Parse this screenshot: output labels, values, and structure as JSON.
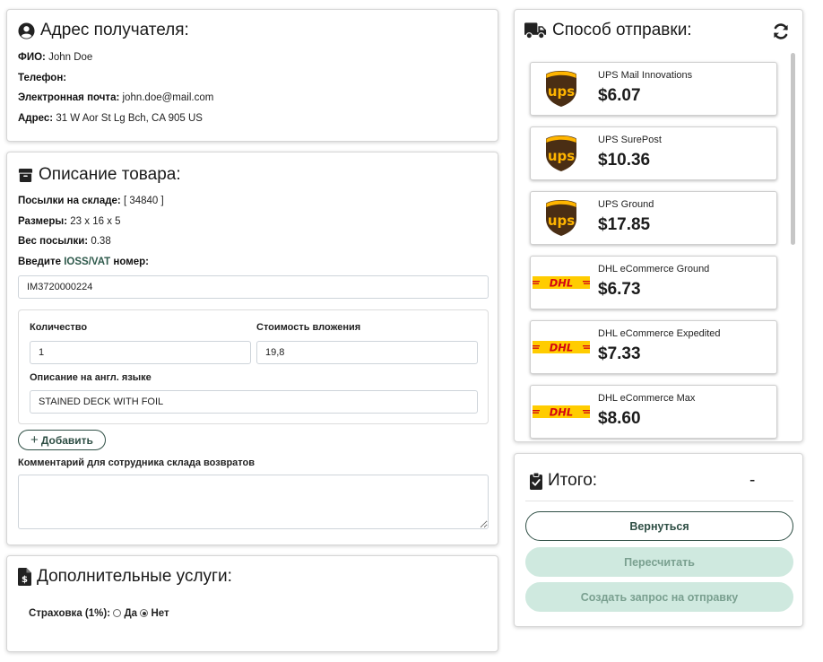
{
  "recipient": {
    "title": "Адрес получателя:",
    "fio_label": "ФИО:",
    "fio_value": "John Doe",
    "phone_label": "Телефон:",
    "phone_value": "",
    "email_label": "Электронная почта:",
    "email_value": "john.doe@mail.com",
    "address_label": "Адрес:",
    "address_value": "31 W Aor St Lg Bch, CA 905 US"
  },
  "product": {
    "title": "Описание товара:",
    "parcels_label": "Посылки на складе:",
    "parcels_value": "[ 34840 ]",
    "size_label": "Размеры:",
    "size_value": "23 x 16 x 5",
    "weight_label": "Вес посылки:",
    "weight_value": "0.38",
    "ioss_prefix": "Введите",
    "ioss_link": "IOSS/VAT",
    "ioss_suffix": "номер:",
    "ioss_value": "IM3720000224",
    "qty_label": "Количество",
    "qty_value": "1",
    "cost_label": "Стоимость вложения",
    "cost_value": "19,8",
    "desc_label": "Описание на англ. языке",
    "desc_value": "STAINED DECK WITH FOIL",
    "add_label": "Добавить",
    "comment_label": "Комментарий для сотрудника склада возвратов",
    "comment_value": ""
  },
  "extra": {
    "title": "Дополнительные услуги:",
    "insurance_label": "Страховка (1%):",
    "yes_label": "Да",
    "no_label": "Нет",
    "selected": "no"
  },
  "shipping": {
    "title": "Способ отправки:",
    "options": [
      {
        "carrier": "ups",
        "name": "UPS Mail Innovations",
        "price": "$6.07"
      },
      {
        "carrier": "ups",
        "name": "UPS SurePost",
        "price": "$10.36"
      },
      {
        "carrier": "ups",
        "name": "UPS Ground",
        "price": "$17.85"
      },
      {
        "carrier": "dhl",
        "name": "DHL eCommerce Ground",
        "price": "$6.73"
      },
      {
        "carrier": "dhl",
        "name": "DHL eCommerce Expedited",
        "price": "$7.33"
      },
      {
        "carrier": "dhl",
        "name": "DHL eCommerce Max",
        "price": "$8.60"
      }
    ]
  },
  "total": {
    "title": "Итого:",
    "value": "-",
    "back_label": "Вернуться",
    "recalc_label": "Пересчитать",
    "create_label": "Создать запрос на отправку"
  },
  "colors": {
    "accent": "#2f4f45",
    "disabled_bg": "#cfe9df",
    "ups_brown": "#4a2e14",
    "ups_gold": "#ffb500",
    "dhl_yellow": "#ffcc00",
    "dhl_red": "#d40511"
  }
}
